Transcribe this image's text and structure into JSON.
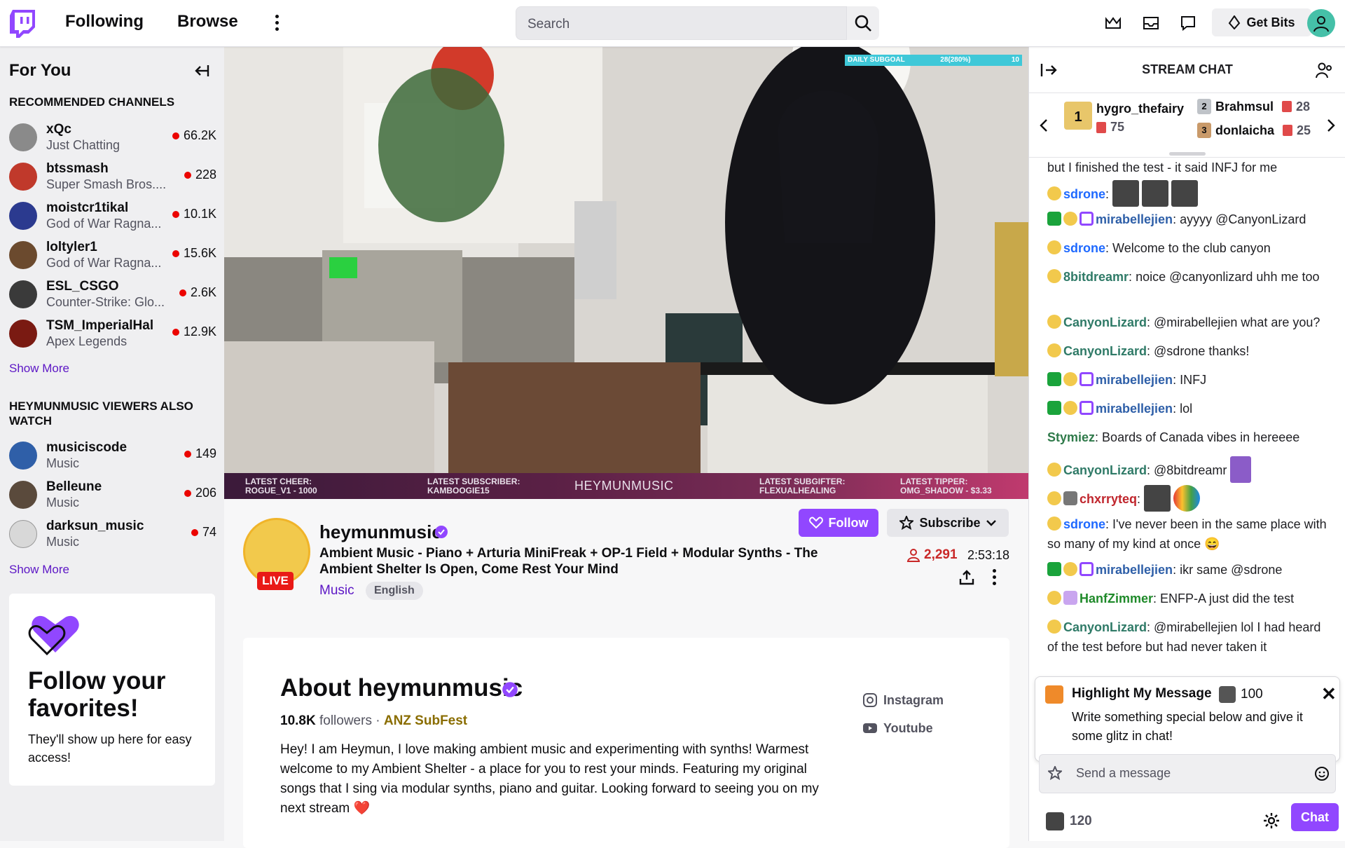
{
  "nav": {
    "following": "Following",
    "browse": "Browse",
    "search_placeholder": "Search",
    "get_bits": "Get Bits"
  },
  "sidebar": {
    "title": "For You",
    "recommended_heading": "RECOMMENDED CHANNELS",
    "recommended": [
      {
        "name": "xQc",
        "game": "Just Chatting",
        "viewers": "66.2K",
        "color": "#8a8a8a"
      },
      {
        "name": "btssmash",
        "game": "Super Smash Bros....",
        "viewers": "228",
        "color": "#c0392b"
      },
      {
        "name": "moistcr1tikal",
        "game": "God of War Ragna...",
        "viewers": "10.1K",
        "color": "#2b3a8f"
      },
      {
        "name": "loltyler1",
        "game": "God of War Ragna...",
        "viewers": "15.6K",
        "color": "#6b4a2e"
      },
      {
        "name": "ESL_CSGO",
        "game": "Counter-Strike: Glo...",
        "viewers": "2.6K",
        "color": "#3a3a3a"
      },
      {
        "name": "TSM_ImperialHal",
        "game": "Apex Legends",
        "viewers": "12.9K",
        "color": "#7a1a12"
      }
    ],
    "show_more": "Show More",
    "also_watch_heading": "HEYMUNMUSIC VIEWERS ALSO WATCH",
    "also_watch": [
      {
        "name": "musiciscode",
        "game": "Music",
        "viewers": "149",
        "color": "#2f5fa8"
      },
      {
        "name": "Belleune",
        "game": "Music",
        "viewers": "206",
        "color": "#5a4a3c"
      },
      {
        "name": "darksun_music",
        "game": "Music",
        "viewers": "74",
        "color": "#d8d8d8"
      }
    ],
    "show_more_2": "Show More",
    "follow_card": {
      "title": "Follow your favorites!",
      "subtitle": "They'll show up here for easy access!"
    }
  },
  "video": {
    "subgoal_label": "DAILY SUBGOAL",
    "subgoal_value": "28(280%)",
    "subgoal_target": "10",
    "overlay": {
      "cheer": "LATEST CHEER: ROGUE_V1 - 1000",
      "subscriber": "LATEST SUBSCRIBER: KAMBOOGIE15",
      "brand": "HEYMUNMUSIC",
      "subgifter": "LATEST SUBGIFTER: FLEXUALHEALING",
      "tipper": "LATEST TIPPER: OMG_SHADOW - $3.33"
    }
  },
  "channel": {
    "live": "LIVE",
    "name": "heymunmusic",
    "title": "Ambient Music - Piano + Arturia MiniFreak + OP-1 Field + Modular Synths - The Ambient Shelter Is Open, Come Rest Your Mind",
    "category": "Music",
    "tag": "English",
    "follow": "Follow",
    "subscribe": "Subscribe",
    "viewers": "2,291",
    "uptime": "2:53:18"
  },
  "about": {
    "title": "About heymunmusic",
    "followers_count": "10.8K",
    "followers_label": "followers",
    "separator": "·",
    "team": "ANZ SubFest",
    "description": "Hey! I am Heymun, I love making ambient music and experimenting with synths! Warmest welcome to my Ambient Shelter - a place for you to rest your minds. Featuring my original songs that I sing via modular synths, piano and guitar. Looking forward to seeing you on my next stream ❤️",
    "instagram": "Instagram",
    "youtube": "Youtube"
  },
  "chat": {
    "title": "STREAM CHAT",
    "leaderboard": [
      {
        "name": "hygro_thefairy",
        "count": "75",
        "rank": "1"
      },
      {
        "name": "Brahmsul",
        "count": "28",
        "rank": "2"
      },
      {
        "name": "donlaicha",
        "count": "25",
        "rank": "3"
      }
    ],
    "top_text": "but I finished the test - it said INFJ for me",
    "messages": [
      {
        "user": "sdrone",
        "color": "#1e69ff",
        "text": ""
      },
      {
        "user": "mirabellejien",
        "color": "#2e5fa8",
        "text": "ayyyy @CanyonLizard"
      },
      {
        "user": "sdrone",
        "color": "#1e69ff",
        "text": "Welcome to the club canyon"
      },
      {
        "user": "8bitdreamr",
        "color": "#2f7a67",
        "text": "noice @canyonlizard uhh me too"
      },
      {
        "user": "CanyonLizard",
        "color": "#2f7a67",
        "text": "@mirabellejien what are you?"
      },
      {
        "user": "CanyonLizard",
        "color": "#2f7a67",
        "text": "@sdrone thanks!"
      },
      {
        "user": "mirabellejien",
        "color": "#2e5fa8",
        "text": "INFJ"
      },
      {
        "user": "mirabellejien",
        "color": "#2e5fa8",
        "text": "lol"
      },
      {
        "user": "Stymiez",
        "color": "#2f7a4a",
        "text": "Boards of Canada vibes in hereeee"
      },
      {
        "user": "CanyonLizard",
        "color": "#2f7a67",
        "text": "@8bitdreamr"
      },
      {
        "user": "chxrryteq",
        "color": "#c0262d",
        "text": ""
      },
      {
        "user": "sdrone",
        "color": "#1e69ff",
        "text": "I've never been in the same place with so many of my kind at once 😄"
      },
      {
        "user": "mirabellejien",
        "color": "#2e5fa8",
        "text": "ikr same @sdrone"
      },
      {
        "user": "HanfZimmer",
        "color": "#1f8a2a",
        "text": "ENFP-A just did the test"
      },
      {
        "user": "CanyonLizard",
        "color": "#2f7a67",
        "text": "@mirabellejien  lol I had heard of the test before but had never taken it"
      }
    ],
    "highlight": {
      "title": "Highlight My Message",
      "cost": "100",
      "text": "Write something special below and give it some glitz in chat!"
    },
    "send_placeholder": "Send a message",
    "points": "120",
    "chat_button": "Chat"
  }
}
